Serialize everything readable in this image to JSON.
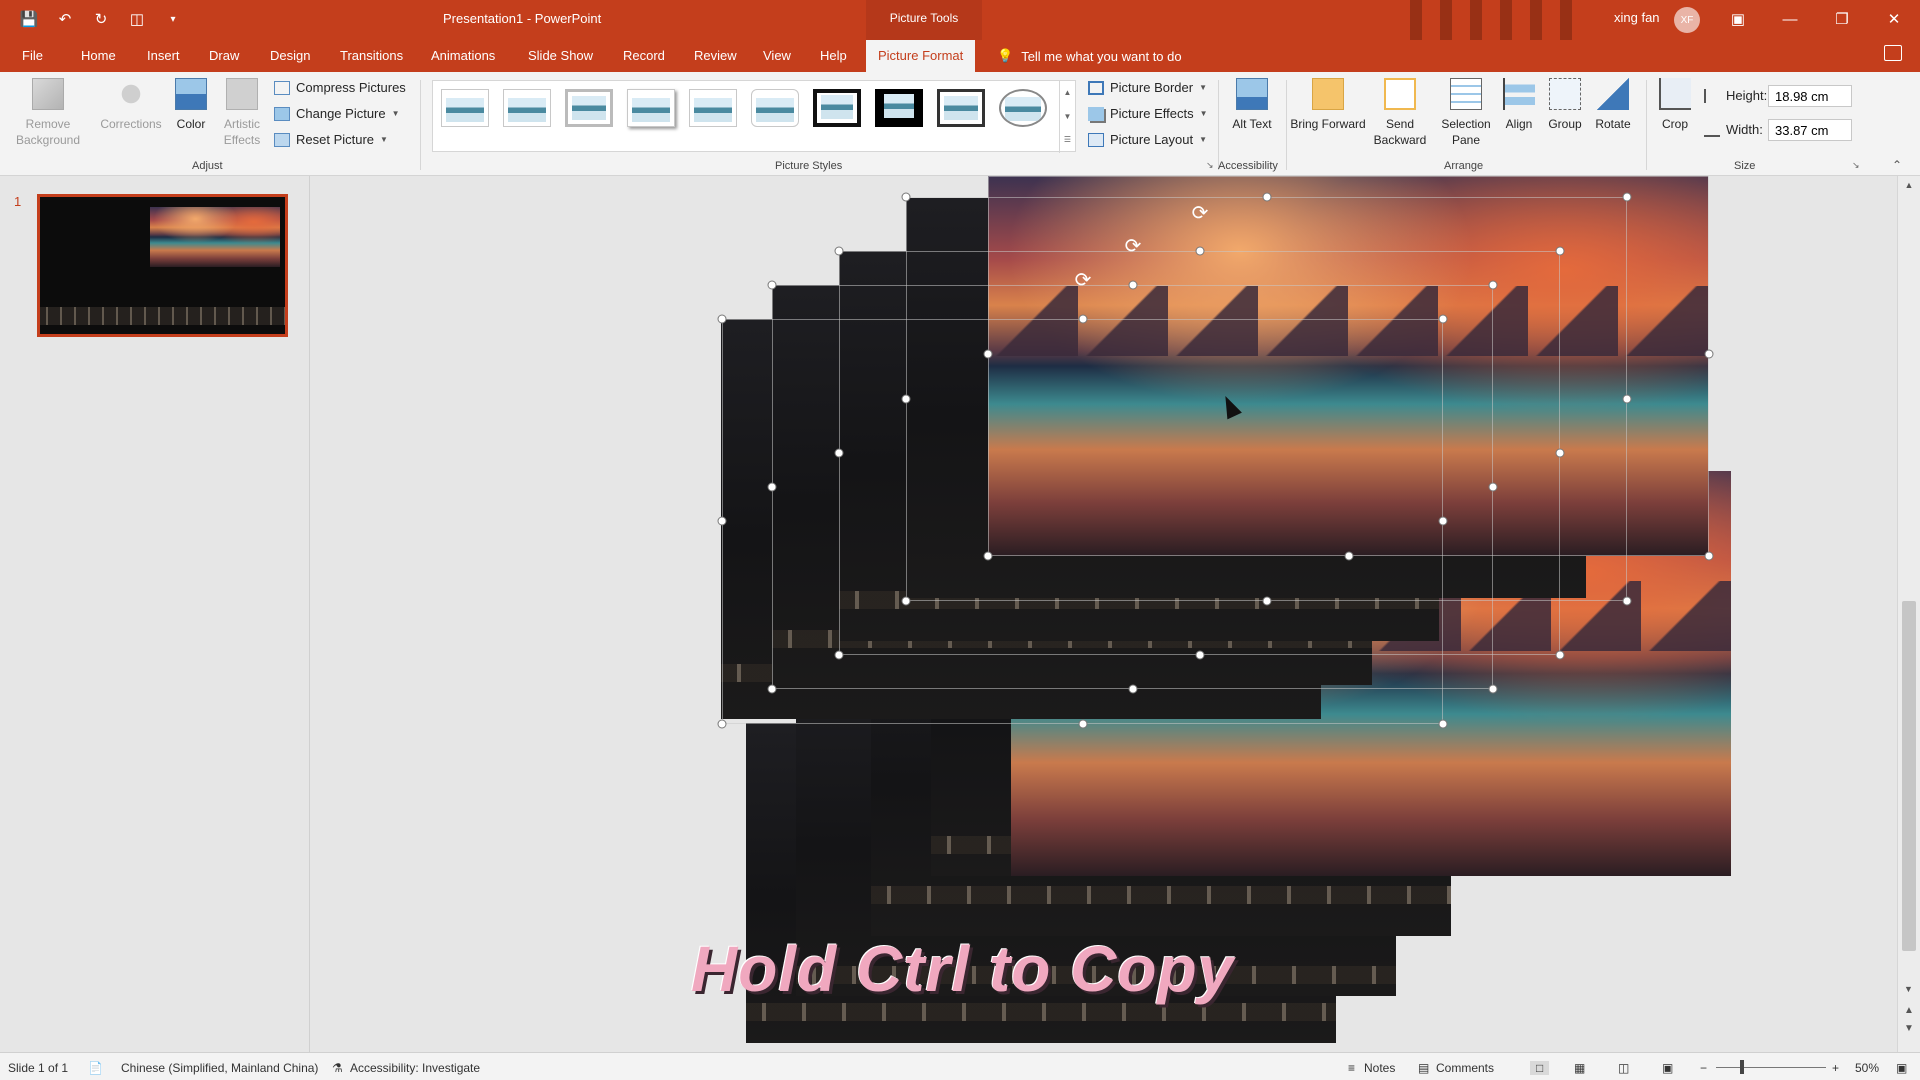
{
  "window": {
    "title": "Presentation1  -  PowerPoint",
    "tools_context": "Picture Tools",
    "user_name": "xing fan",
    "user_initials": "XF"
  },
  "menu": {
    "tabs": [
      "File",
      "Home",
      "Insert",
      "Draw",
      "Design",
      "Transitions",
      "Animations",
      "Slide Show",
      "Record",
      "Review",
      "View",
      "Help",
      "Picture Format"
    ],
    "active_tab": "Picture Format",
    "tell_me": "Tell me what you want to do"
  },
  "ribbon": {
    "adjust": {
      "label": "Adjust",
      "remove_background": "Remove Background",
      "corrections": "Corrections",
      "color": "Color",
      "artistic_effects": "Artistic Effects",
      "compress_pictures": "Compress Pictures",
      "change_picture": "Change Picture",
      "reset_picture": "Reset Picture"
    },
    "picture_styles": {
      "label": "Picture Styles",
      "picture_border": "Picture Border",
      "picture_effects": "Picture Effects",
      "picture_layout": "Picture Layout"
    },
    "accessibility": {
      "label": "Accessibility",
      "alt_text": "Alt Text"
    },
    "arrange": {
      "label": "Arrange",
      "bring_forward": "Bring Forward",
      "send_backward": "Send Backward",
      "selection_pane": "Selection Pane",
      "align": "Align",
      "group": "Group",
      "rotate": "Rotate"
    },
    "size": {
      "label": "Size",
      "crop": "Crop",
      "height_label": "Height:",
      "height_value": "18.98 cm",
      "width_label": "Width:",
      "width_value": "33.87 cm"
    }
  },
  "slides": {
    "current_number": "1"
  },
  "slide": {
    "caption": "Hold Ctrl to Copy"
  },
  "status": {
    "slide_info": "Slide 1 of 1",
    "language": "Chinese (Simplified, Mainland China)",
    "accessibility": "Accessibility: Investigate",
    "notes": "Notes",
    "comments": "Comments",
    "zoom": "50%"
  },
  "colors": {
    "accent": "#c43e1c",
    "ribbon_bg": "#f3f3f3",
    "caption": "#f0a8bf"
  }
}
